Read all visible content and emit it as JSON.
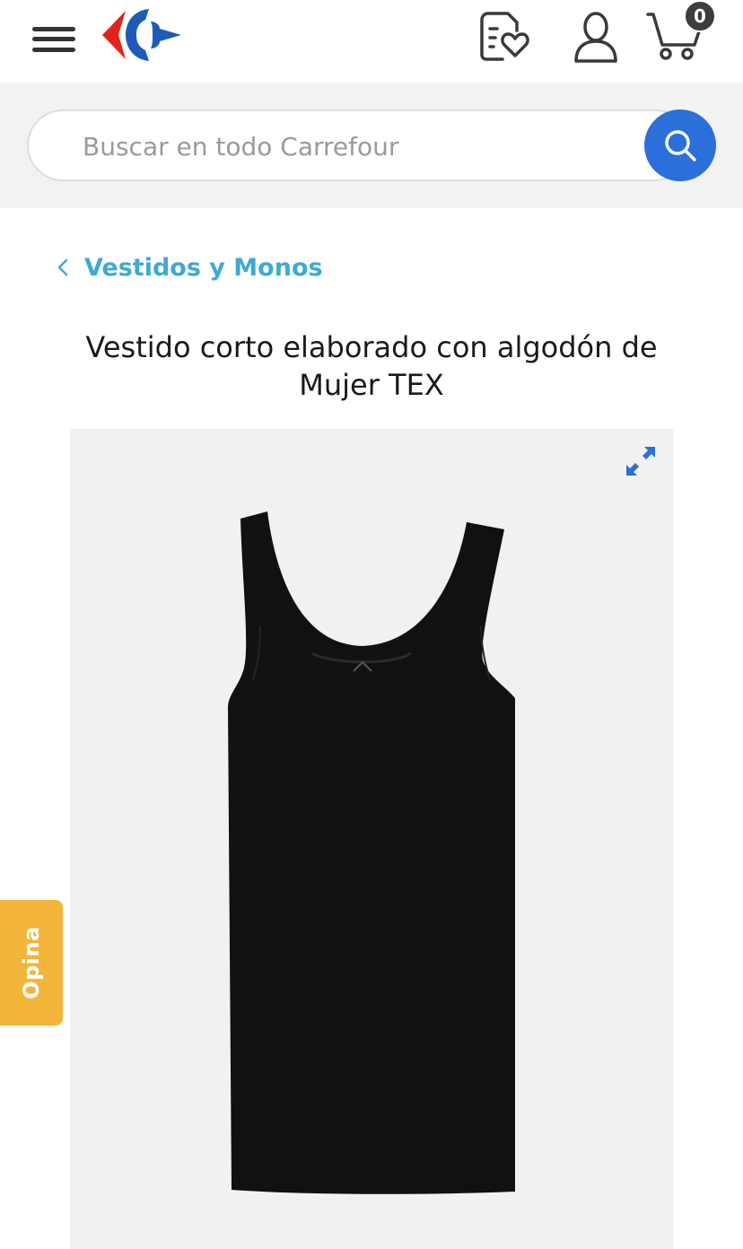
{
  "header": {
    "cart_count": "0",
    "logo_colors": {
      "red": "#e2231a",
      "blue": "#1e5bb8"
    }
  },
  "search": {
    "placeholder": "Buscar en todo Carrefour",
    "button_color": "#2b6fdb"
  },
  "breadcrumb": {
    "label": "Vestidos y Monos"
  },
  "product": {
    "title": "Vestido corto elaborado con algodón de Mujer TEX"
  },
  "feedback_tab": {
    "label": "Opina"
  },
  "icons": {
    "menu": "hamburger-menu-icon",
    "list": "shopping-list-heart-icon",
    "user": "user-icon",
    "cart": "cart-icon",
    "search": "search-icon",
    "expand": "expand-icon",
    "back": "chevron-left-icon"
  }
}
